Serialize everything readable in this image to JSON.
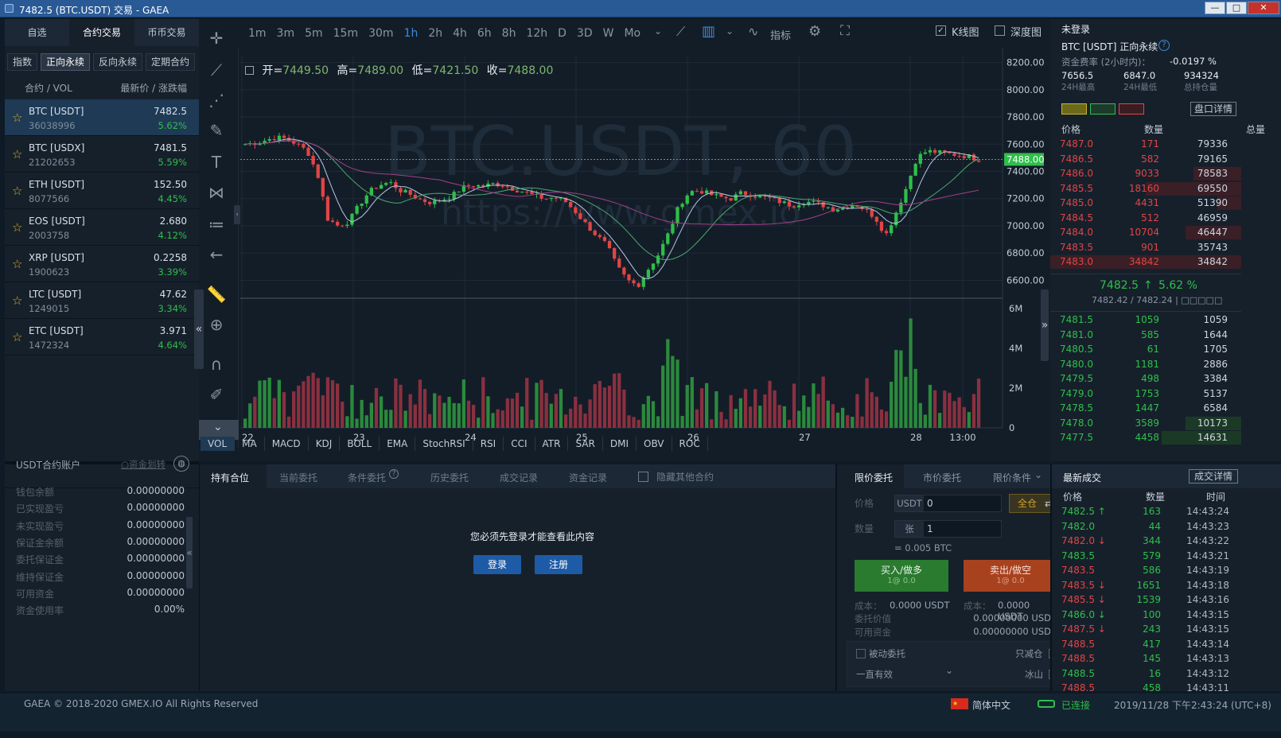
{
  "window": {
    "title": "7482.5 (BTC.USDT) 交易 - GAEA",
    "min": "—",
    "max": "□",
    "close": "✕"
  },
  "left": {
    "tabs": [
      "自选",
      "合约交易",
      "币币交易"
    ],
    "subtabs": [
      "指数",
      "正向永续",
      "反向永续",
      "定期合约"
    ],
    "header": {
      "pair": "合约 / VOL",
      "price": "最新价 / 涨跌幅"
    },
    "markets": [
      {
        "name": "BTC [USDT]",
        "vol": "36038996",
        "price": "7482.5",
        "change": "5.62%"
      },
      {
        "name": "BTC [USDX]",
        "vol": "21202653",
        "price": "7481.5",
        "change": "5.59%"
      },
      {
        "name": "ETH [USDT]",
        "vol": "8077566",
        "price": "152.50",
        "change": "4.45%"
      },
      {
        "name": "EOS [USDT]",
        "vol": "2003758",
        "price": "2.680",
        "change": "4.12%"
      },
      {
        "name": "XRP [USDT]",
        "vol": "1900623",
        "price": "0.2258",
        "change": "3.39%"
      },
      {
        "name": "LTC [USDT]",
        "vol": "1249015",
        "price": "47.62",
        "change": "3.34%"
      },
      {
        "name": "ETC [USDT]",
        "vol": "1472324",
        "price": "3.971",
        "change": "4.64%"
      }
    ]
  },
  "toolbar": {
    "intervals": [
      "1m",
      "3m",
      "5m",
      "15m",
      "30m",
      "1h",
      "2h",
      "4h",
      "6h",
      "8h",
      "12h",
      "D",
      "3D",
      "W",
      "Mo"
    ],
    "active": "1h",
    "indicator": "指标",
    "kline": "K线图",
    "depth": "深度图"
  },
  "ohlc": {
    "open_label": "开=",
    "open": "7449.50",
    "high_label": "高=",
    "high": "7489.00",
    "low_label": "低=",
    "low": "7421.50",
    "close_label": "收=",
    "close": "7488.00"
  },
  "watermark": {
    "l1": "BTC.USDT, 60",
    "l2": "https://www.gmex.io"
  },
  "chart_data": {
    "type": "candlestick",
    "price_ticks": [
      "8200.00",
      "8000.00",
      "7800.00",
      "7600.00",
      "7400.00",
      "7200.00",
      "7000.00",
      "6800.00",
      "6600.00"
    ],
    "last_price": "7488.00",
    "ylim": [
      6480,
      8250
    ],
    "vol_ticks": [
      "6M",
      "4M",
      "2M",
      "0"
    ],
    "x_ticks": [
      "22",
      "23",
      "24",
      "25",
      "26",
      "27",
      "28",
      "13:00"
    ],
    "close_path": [
      7600,
      7610,
      7630,
      7650,
      7640,
      7600,
      7550,
      7380,
      7050,
      7000,
      7030,
      7150,
      7250,
      7300,
      7320,
      7260,
      7230,
      7190,
      7170,
      7190,
      7220,
      7280,
      7300,
      7290,
      7310,
      7300,
      7270,
      7250,
      7220,
      7200,
      7210,
      7180,
      7100,
      7010,
      6930,
      6860,
      6700,
      6600,
      6560,
      6680,
      6790,
      6950,
      7150,
      7250,
      7260,
      7230,
      7210,
      7200,
      7240,
      7230,
      7210,
      7200,
      7170,
      7150,
      7180,
      7170,
      7150,
      7120,
      7140,
      7160,
      7120,
      7060,
      6930,
      7100,
      7280,
      7500,
      7550,
      7540,
      7530,
      7520,
      7510,
      7488
    ]
  },
  "indicators": [
    "VOL",
    "MA",
    "MACD",
    "KDJ",
    "BOLL",
    "EMA",
    "StochRSI",
    "RSI",
    "CCI",
    "ATR",
    "SAR",
    "DMI",
    "OBV",
    "ROC"
  ],
  "right": {
    "login": "未登录",
    "contract": "BTC [USDT] 正向永续",
    "funding_label": "资金费率 (2小时内)：",
    "funding": "-0.0197 %",
    "stats": [
      {
        "v": "7656.5",
        "k": "24H最高"
      },
      {
        "v": "6847.0",
        "k": "24H最低"
      },
      {
        "v": "934324",
        "k": "总持仓量"
      }
    ],
    "detail_btn": "盘口详情",
    "ob_header": [
      "价格",
      "数量",
      "总量"
    ],
    "asks": [
      {
        "p": "7487.0",
        "q": "171",
        "s": "79336",
        "w": 0
      },
      {
        "p": "7486.5",
        "q": "582",
        "s": "79165",
        "w": 0
      },
      {
        "p": "7486.0",
        "q": "9033",
        "s": "78583",
        "w": 60
      },
      {
        "p": "7485.5",
        "q": "18160",
        "s": "69550",
        "w": 120
      },
      {
        "p": "7485.0",
        "q": "4431",
        "s": "51390",
        "w": 30
      },
      {
        "p": "7484.5",
        "q": "512",
        "s": "46959",
        "w": 0
      },
      {
        "p": "7484.0",
        "q": "10704",
        "s": "46447",
        "w": 70
      },
      {
        "p": "7483.5",
        "q": "901",
        "s": "35743",
        "w": 0
      },
      {
        "p": "7483.0",
        "q": "34842",
        "s": "34842",
        "w": 240
      }
    ],
    "mid_price": "7482.5",
    "mid_arrow": "↑",
    "mid_change": "5.62 %",
    "mid_sub": "7482.42 / 7482.24 | □□□□□",
    "bids": [
      {
        "p": "7481.5",
        "q": "1059",
        "s": "1059",
        "w": 0
      },
      {
        "p": "7481.0",
        "q": "585",
        "s": "1644",
        "w": 0
      },
      {
        "p": "7480.5",
        "q": "61",
        "s": "1705",
        "w": 0
      },
      {
        "p": "7480.0",
        "q": "1181",
        "s": "2886",
        "w": 0
      },
      {
        "p": "7479.5",
        "q": "498",
        "s": "3384",
        "w": 0
      },
      {
        "p": "7479.0",
        "q": "1753",
        "s": "5137",
        "w": 0
      },
      {
        "p": "7478.5",
        "q": "1447",
        "s": "6584",
        "w": 0
      },
      {
        "p": "7478.0",
        "q": "3589",
        "s": "10173",
        "w": 70
      },
      {
        "p": "7477.5",
        "q": "4458",
        "s": "14631",
        "w": 100
      }
    ],
    "trades_title": "最新成交",
    "trades_btn": "成交详情",
    "trades_header": [
      "价格",
      "数量",
      "时间"
    ],
    "trades": [
      {
        "p": "7482.5 ↑",
        "q": "163",
        "t": "14:43:24",
        "c": "g"
      },
      {
        "p": "7482.0",
        "q": "44",
        "t": "14:43:23",
        "c": "g"
      },
      {
        "p": "7482.0 ↓",
        "q": "344",
        "t": "14:43:22",
        "c": "r"
      },
      {
        "p": "7483.5",
        "q": "579",
        "t": "14:43:21",
        "c": "g"
      },
      {
        "p": "7483.5",
        "q": "586",
        "t": "14:43:19",
        "c": "r"
      },
      {
        "p": "7483.5 ↓",
        "q": "1651",
        "t": "14:43:18",
        "c": "r"
      },
      {
        "p": "7485.5 ↓",
        "q": "1539",
        "t": "14:43:16",
        "c": "r"
      },
      {
        "p": "7486.0 ↓",
        "q": "100",
        "t": "14:43:15",
        "c": "g"
      },
      {
        "p": "7487.5 ↓",
        "q": "243",
        "t": "14:43:15",
        "c": "r"
      },
      {
        "p": "7488.5",
        "q": "417",
        "t": "14:43:14",
        "c": "r"
      },
      {
        "p": "7488.5",
        "q": "145",
        "t": "14:43:13",
        "c": "r"
      },
      {
        "p": "7488.5",
        "q": "16",
        "t": "14:43:12",
        "c": "g"
      },
      {
        "p": "7488.5",
        "q": "458",
        "t": "14:43:11",
        "c": "r"
      }
    ]
  },
  "account": {
    "title": "USDT合约账户",
    "transfer": "○资金划转",
    "rows": [
      {
        "k": "钱包余额",
        "v": "0.00000000"
      },
      {
        "k": "已实现盈亏",
        "v": "0.00000000"
      },
      {
        "k": "未实现盈亏",
        "v": "0.00000000"
      },
      {
        "k": "保证金余额",
        "v": "0.00000000"
      },
      {
        "k": "委托保证金",
        "v": "0.00000000"
      },
      {
        "k": "维持保证金",
        "v": "0.00000000"
      },
      {
        "k": "可用资金",
        "v": "0.00000000"
      },
      {
        "k": "资金使用率",
        "v": "0.00%"
      }
    ]
  },
  "orders": {
    "tabs": [
      "持有合位",
      "当前委托",
      "条件委托",
      "历史委托",
      "成交记录",
      "资金记录"
    ],
    "hide_other": "隐藏其他合约",
    "login_msg": "您必须先登录才能查看此内容",
    "login": "登录",
    "register": "注册"
  },
  "trade": {
    "tabs": [
      "限价委托",
      "市价委托",
      "限价条件"
    ],
    "price_label": "价格",
    "price_unit": "USDT",
    "price_value": "0",
    "full": "全仓",
    "qty_label": "数量",
    "qty_unit": "张",
    "qty_value": "1",
    "btc_eq": "= 0.005 BTC",
    "buy": "买入/做多",
    "buy_sub": "1@ 0.0",
    "sell": "卖出/做空",
    "sell_sub": "1@ 0.0",
    "cost_label": "成本：",
    "cost_buy": "0.0000 USDT",
    "cost_sell": "0.0000 USDT",
    "order_value_label": "委托价值",
    "order_value": "0.00000000 USDT",
    "avail_label": "可用资金",
    "avail": "0.00000000 USDT",
    "passive": "被动委托",
    "reduce": "只减仓",
    "tif": "一直有效",
    "iceberg": "冰山"
  },
  "footer": {
    "copyright": "GAEA © 2018-2020 GMEX.IO All Rights Reserved",
    "lang": "简体中文",
    "conn": "已连接",
    "time": "2019/11/28 下午2:43:24 (UTC+8)"
  }
}
